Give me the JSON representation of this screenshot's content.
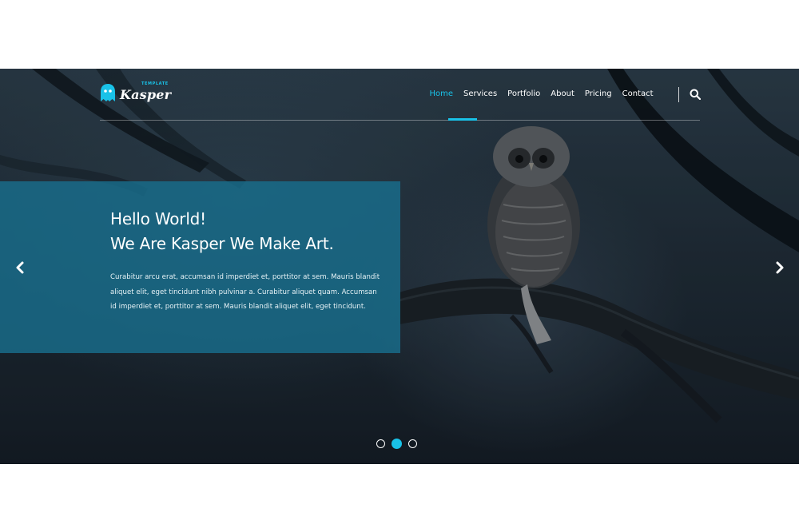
{
  "brand": {
    "name": "Kasper",
    "tag": "TEMPLATE",
    "accent_color": "#19c2e8"
  },
  "nav": {
    "items": [
      {
        "label": "Home",
        "active": true
      },
      {
        "label": "Services",
        "active": false
      },
      {
        "label": "Portfolio",
        "active": false
      },
      {
        "label": "About",
        "active": false
      },
      {
        "label": "Pricing",
        "active": false
      },
      {
        "label": "Contact",
        "active": false
      }
    ],
    "search_icon": "search-icon"
  },
  "hero": {
    "headline_line1": "Hello World!",
    "headline_line2": "We Are Kasper We Make Art.",
    "description": "Curabitur arcu erat, accumsan id imperdiet et, porttitor at sem. Mauris blandit aliquet elit, eget tincidunt nibh pulvinar a. Curabitur aliquet quam. Accumsan id imperdiet et, porttitor at sem. Mauris blandit aliquet elit, eget tincidunt.",
    "box_color": "#186e8c",
    "prev_icon": "chevron-left-icon",
    "next_icon": "chevron-right-icon"
  },
  "slider": {
    "count": 3,
    "active_index": 1
  }
}
